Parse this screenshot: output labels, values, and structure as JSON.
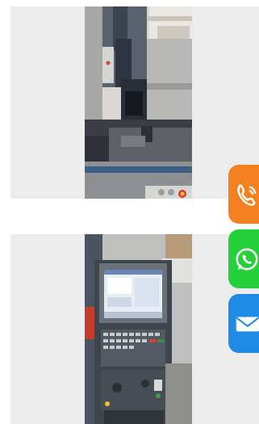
{
  "gallery": {
    "images": [
      {
        "subject": "cnc-milling-machine-spindle-and-table"
      },
      {
        "subject": "cnc-control-panel-with-display"
      }
    ]
  },
  "contact_buttons": [
    {
      "kind": "phone",
      "icon": "phone-icon",
      "color": "#f48120"
    },
    {
      "kind": "whatsapp",
      "icon": "whatsapp-icon",
      "color": "#25d03a"
    },
    {
      "kind": "email",
      "icon": "mail-icon",
      "color": "#1f8ae3"
    }
  ]
}
